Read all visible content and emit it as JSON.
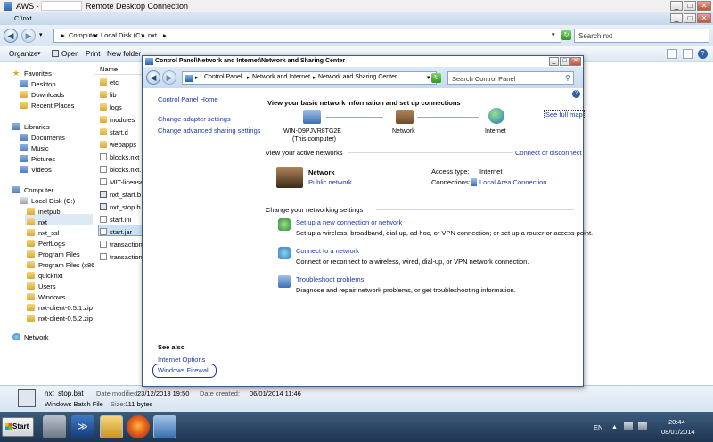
{
  "rdc": {
    "title": "AWS -",
    "app": "Remote Desktop Connection",
    "buttons": [
      "_",
      "□",
      "✕"
    ]
  },
  "explorer": {
    "caption": "C:\\nxt",
    "path": [
      "Computer",
      "Local Disk (C:)",
      "nxt"
    ],
    "search_placeholder": "Search nxt",
    "toolbar": [
      "Organize",
      "Open",
      "Print",
      "New folder"
    ],
    "column_name": "Name",
    "nav": {
      "favorites": "Favorites",
      "fav_items": [
        "Desktop",
        "Downloads",
        "Recent Places"
      ],
      "libraries": "Libraries",
      "lib_items": [
        "Documents",
        "Music",
        "Pictures",
        "Videos"
      ],
      "computer": "Computer",
      "drive": "Local Disk (C:)",
      "drive_items": [
        "inetpub",
        "nxt",
        "nxt_ssl",
        "PerfLogs",
        "Program Files",
        "Program Files (x86)",
        "quicknxt",
        "Users",
        "Windows",
        "nxt-client-0.5.1.zip",
        "nxt-client-0.5.2.zip"
      ],
      "network": "Network"
    },
    "files": [
      "etc",
      "lib",
      "logs",
      "modules",
      "start.d",
      "webapps",
      "blocks.nxt",
      "blocks.nxt.",
      "MIT-license",
      "nxt_start.b",
      "nxt_stop.b",
      "start.ini",
      "start.jar",
      "transaction",
      "transaction"
    ],
    "details": {
      "name": "nxt_stop.bat",
      "type": "Windows Batch File",
      "modified_label": "Date modified:",
      "modified": "23/12/2013 19:50",
      "size_label": "Size:",
      "size": "111 bytes",
      "created_label": "Date created:",
      "created": "06/01/2014 11:46"
    }
  },
  "cp": {
    "title": "Control Panel\\Network and Internet\\Network and Sharing Center",
    "path": [
      "Control Panel",
      "Network and Internet",
      "Network and Sharing Center"
    ],
    "search_placeholder": "Search Control Panel",
    "left": {
      "home": "Control Panel Home",
      "adapter": "Change adapter settings",
      "sharing": "Change advanced sharing settings",
      "see_also": "See also",
      "internet_options": "Internet Options",
      "firewall": "Windows Firewall"
    },
    "main": {
      "heading": "View your basic network information and set up connections",
      "see_full_map": "See full map",
      "node_computer": "WIN-D9PJVR8TG2E",
      "node_computer_sub": "(This computer)",
      "node_network": "Network",
      "node_internet": "Internet",
      "active_heading": "View your active networks",
      "connect_disconnect": "Connect or disconnect",
      "net_name": "Network",
      "net_type": "Public network",
      "access_label": "Access type:",
      "access_value": "Internet",
      "conn_label": "Connections:",
      "conn_value": "Local Area Connection",
      "settings_heading": "Change your networking settings",
      "tasks": [
        {
          "title": "Set up a new connection or network",
          "desc": "Set up a wireless, broadband, dial-up, ad hoc, or VPN connection; or set up a router or access point."
        },
        {
          "title": "Connect to a network",
          "desc": "Connect or reconnect to a wireless, wired, dial-up, or VPN network connection."
        },
        {
          "title": "Troubleshoot problems",
          "desc": "Diagnose and repair network problems, or get troubleshooting information."
        }
      ]
    }
  },
  "taskbar": {
    "start": "Start",
    "lang": "EN",
    "time": "20:44",
    "date": "08/01/2014"
  },
  "colors": {
    "link": "#1c3aa8",
    "taskbar": "#1f3552",
    "highlight_circle": "#1b2fa6"
  }
}
